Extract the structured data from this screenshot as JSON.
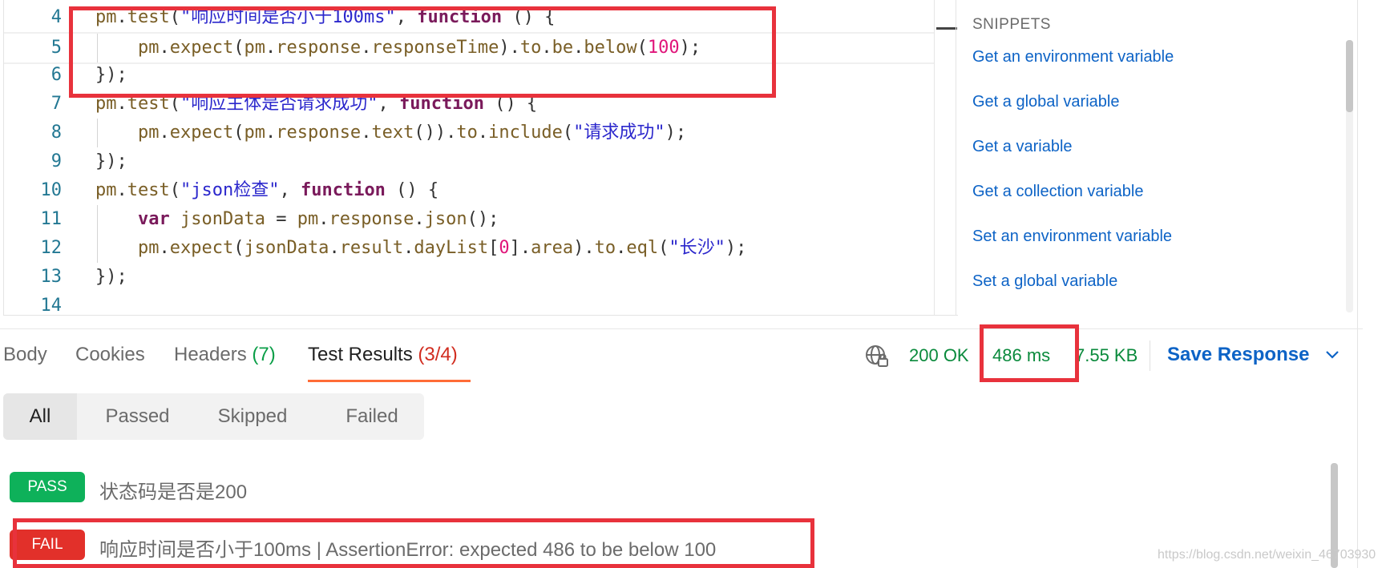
{
  "editor": {
    "lines": [
      {
        "num": "4",
        "parts": [
          [
            "k",
            "pm"
          ],
          [
            "p",
            "."
          ],
          [
            "k",
            "test"
          ],
          [
            "p",
            "("
          ],
          [
            "s",
            "\"响应时间是否小于100ms\""
          ],
          [
            "p",
            ", "
          ],
          [
            "kw",
            "function"
          ],
          [
            "p",
            " () {"
          ]
        ]
      },
      {
        "num": "5",
        "parts": [
          [
            "p",
            "    "
          ],
          [
            "k",
            "pm"
          ],
          [
            "p",
            "."
          ],
          [
            "k",
            "expect"
          ],
          [
            "p",
            "("
          ],
          [
            "k",
            "pm"
          ],
          [
            "p",
            "."
          ],
          [
            "k",
            "response"
          ],
          [
            "p",
            "."
          ],
          [
            "k",
            "responseTime"
          ],
          [
            "p",
            ")."
          ],
          [
            "k",
            "to"
          ],
          [
            "p",
            "."
          ],
          [
            "k",
            "be"
          ],
          [
            "p",
            "."
          ],
          [
            "k",
            "below"
          ],
          [
            "p",
            "("
          ],
          [
            "n",
            "100"
          ],
          [
            "p",
            ");"
          ]
        ]
      },
      {
        "num": "6",
        "parts": [
          [
            "p",
            "});"
          ]
        ]
      },
      {
        "num": "7",
        "parts": [
          [
            "k",
            "pm"
          ],
          [
            "p",
            "."
          ],
          [
            "k",
            "test"
          ],
          [
            "p",
            "("
          ],
          [
            "s",
            "\"响应主体是否请求成功\""
          ],
          [
            "p",
            ", "
          ],
          [
            "kw",
            "function"
          ],
          [
            "p",
            " () {"
          ]
        ]
      },
      {
        "num": "8",
        "parts": [
          [
            "p",
            "    "
          ],
          [
            "k",
            "pm"
          ],
          [
            "p",
            "."
          ],
          [
            "k",
            "expect"
          ],
          [
            "p",
            "("
          ],
          [
            "k",
            "pm"
          ],
          [
            "p",
            "."
          ],
          [
            "k",
            "response"
          ],
          [
            "p",
            "."
          ],
          [
            "k",
            "text"
          ],
          [
            "p",
            "())."
          ],
          [
            "k",
            "to"
          ],
          [
            "p",
            "."
          ],
          [
            "k",
            "include"
          ],
          [
            "p",
            "("
          ],
          [
            "s",
            "\"请求成功\""
          ],
          [
            "p",
            ");"
          ]
        ]
      },
      {
        "num": "9",
        "parts": [
          [
            "p",
            "});"
          ]
        ]
      },
      {
        "num": "10",
        "parts": [
          [
            "k",
            "pm"
          ],
          [
            "p",
            "."
          ],
          [
            "k",
            "test"
          ],
          [
            "p",
            "("
          ],
          [
            "s",
            "\"json检查\""
          ],
          [
            "p",
            ", "
          ],
          [
            "kw",
            "function"
          ],
          [
            "p",
            " () {"
          ]
        ]
      },
      {
        "num": "11",
        "parts": [
          [
            "p",
            "    "
          ],
          [
            "kw",
            "var"
          ],
          [
            "p",
            " "
          ],
          [
            "k",
            "jsonData"
          ],
          [
            "p",
            " = "
          ],
          [
            "k",
            "pm"
          ],
          [
            "p",
            "."
          ],
          [
            "k",
            "response"
          ],
          [
            "p",
            "."
          ],
          [
            "k",
            "json"
          ],
          [
            "p",
            "();"
          ]
        ]
      },
      {
        "num": "12",
        "parts": [
          [
            "p",
            "    "
          ],
          [
            "k",
            "pm"
          ],
          [
            "p",
            "."
          ],
          [
            "k",
            "expect"
          ],
          [
            "p",
            "("
          ],
          [
            "k",
            "jsonData"
          ],
          [
            "p",
            "."
          ],
          [
            "k",
            "result"
          ],
          [
            "p",
            "."
          ],
          [
            "k",
            "dayList"
          ],
          [
            "p",
            "["
          ],
          [
            "n",
            "0"
          ],
          [
            "p",
            "]."
          ],
          [
            "k",
            "area"
          ],
          [
            "p",
            ")."
          ],
          [
            "k",
            "to"
          ],
          [
            "p",
            "."
          ],
          [
            "k",
            "eql"
          ],
          [
            "p",
            "("
          ],
          [
            "s",
            "\"长沙\""
          ],
          [
            "p",
            ");"
          ]
        ]
      },
      {
        "num": "13",
        "parts": [
          [
            "p",
            "});"
          ]
        ]
      },
      {
        "num": "14",
        "parts": []
      }
    ]
  },
  "snippets": {
    "title": "SNIPPETS",
    "items": [
      "Get an environment variable",
      "Get a global variable",
      "Get a variable",
      "Get a collection variable",
      "Set an environment variable",
      "Set a global variable"
    ]
  },
  "response": {
    "tabs": {
      "body": "Body",
      "cookies": "Cookies",
      "headers": "Headers",
      "headers_count": "(7)",
      "tests": "Test Results",
      "tests_count": "(3/4)"
    },
    "status": "200 OK",
    "time": "486 ms",
    "size": "7.55 KB",
    "save_label": "Save Response",
    "save_icon": "chevron-down-icon",
    "network_icon": "globe-lock-icon"
  },
  "filters": {
    "all": "All",
    "passed": "Passed",
    "skipped": "Skipped",
    "failed": "Failed"
  },
  "results": [
    {
      "status": "PASS",
      "name": "状态码是否是200",
      "message": ""
    },
    {
      "status": "FAIL",
      "name": "响应时间是否小于100ms",
      "separator": "|",
      "message": "AssertionError: expected 486 to be below 100"
    }
  ],
  "colors": {
    "pass": "#0eb15a",
    "fail": "#e2302a",
    "link": "#0d63c6",
    "highlight": "#e8323c",
    "active_tab": "#ff6c37"
  },
  "watermark": "https://blog.csdn.net/weixin_46703930"
}
